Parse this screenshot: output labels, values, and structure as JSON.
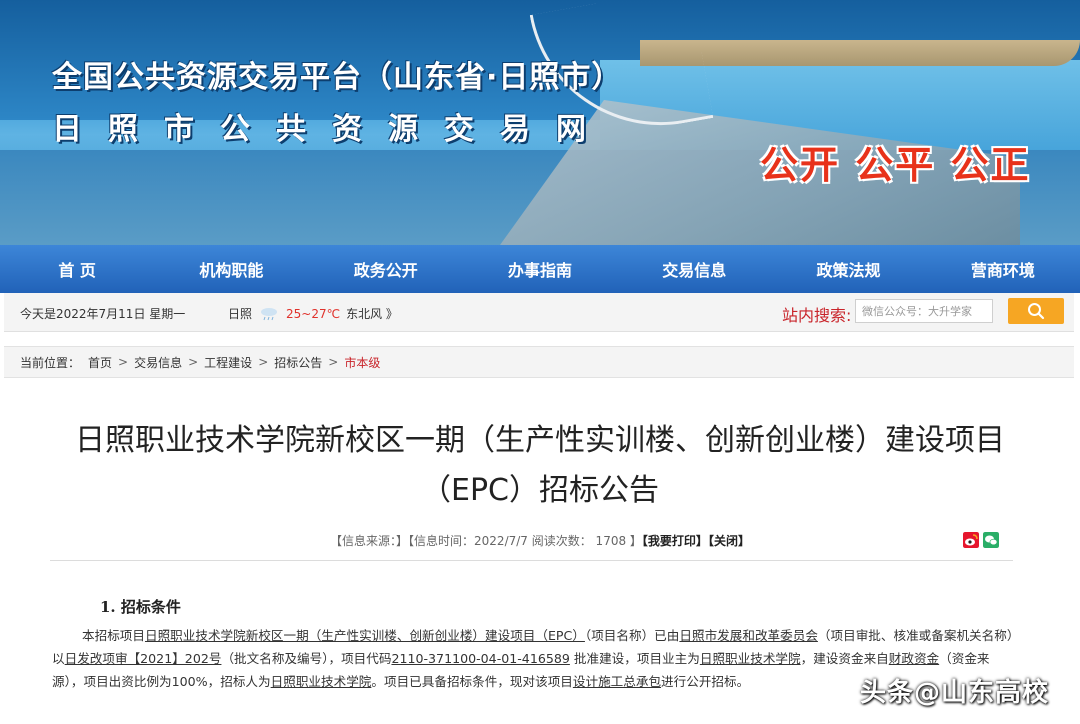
{
  "banner": {
    "title_line1": "全国公共资源交易平台（山东省·日照市）",
    "title_line2": "日照市公共资源交易网",
    "slogan": "公开 公平 公正"
  },
  "nav": {
    "items": [
      "首 页",
      "机构职能",
      "政务公开",
      "办事指南",
      "交易信息",
      "政策法规",
      "营商环境"
    ]
  },
  "infobar": {
    "date": "今天是2022年7月11日 星期一",
    "city": "日照",
    "temp": "25~27℃",
    "wind": "东北风 》",
    "search_label": "站内搜索:",
    "search_value": "微信公众号：大升学家"
  },
  "breadcrumb": {
    "label": "当前位置：",
    "items": [
      "首页",
      "交易信息",
      "工程建设",
      "招标公告"
    ],
    "current": "市本级"
  },
  "article": {
    "title": "日照职业技术学院新校区一期（生产性实训楼、创新创业楼）建设项目（EPC）招标公告",
    "meta_source": "【信息来源：】【信息时间：2022/7/7 阅读次数： 1708 】",
    "meta_print": "【我要打印】",
    "meta_close": "【关闭】",
    "section1_title": "1. 招标条件",
    "p1": "本招标项目",
    "p1_project": "日照职业技术学院新校区一期（生产性实训楼、创新创业楼）建设项目（EPC）",
    "p2": "（项目名称）已由",
    "p2_org": "日照市发展和改革委员会",
    "p3": "（项目审批、核准或备案机关名称）以",
    "p3_doc": "日发改项审【2021】202号",
    "p4": "（批文名称及编号），项目代码",
    "p4_code": "2110-371100-04-01-416589",
    "p5": " 批准建设，项目业主为",
    "p5_owner": "日照职业技术学院",
    "p6": "，建设资金来自",
    "p6_fund": "财政资金",
    "p7": "（资金来源），项目出资比例为100%，招标人为",
    "p7_tenderer": "日照职业技术学院",
    "p8": "。项目已具备招标条件，现对该项目",
    "p8_scope": "设计施工总承包",
    "p9": "进行公开招标。"
  },
  "watermark": "头条@山东高校",
  "colors": {
    "nav": "#2162b8",
    "accent_red": "#c9242a",
    "search_btn": "#f6a623"
  }
}
